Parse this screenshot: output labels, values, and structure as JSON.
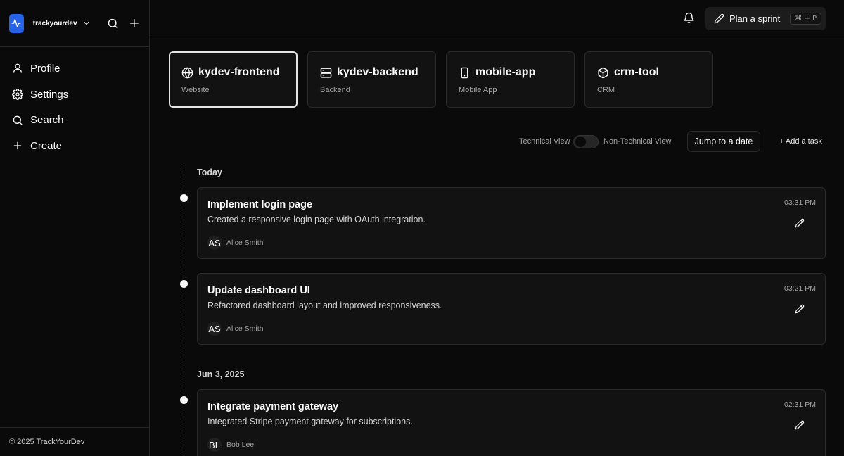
{
  "sidebar": {
    "org_name": "trackyourdev",
    "nav": [
      {
        "label": "Profile",
        "icon": "user-icon"
      },
      {
        "label": "Settings",
        "icon": "gear-icon"
      },
      {
        "label": "Search",
        "icon": "search-icon"
      },
      {
        "label": "Create",
        "icon": "plus-icon"
      }
    ],
    "footer": "© 2025 TrackYourDev"
  },
  "topbar": {
    "plan_label": "Plan a sprint",
    "plan_shortcut": "⌘ + P"
  },
  "projects": [
    {
      "name": "kydev-frontend",
      "type": "Website",
      "icon": "globe-icon",
      "active": true
    },
    {
      "name": "kydev-backend",
      "type": "Backend",
      "icon": "server-icon",
      "active": false
    },
    {
      "name": "mobile-app",
      "type": "Mobile App",
      "icon": "smartphone-icon",
      "active": false
    },
    {
      "name": "crm-tool",
      "type": "CRM",
      "icon": "package-icon",
      "active": false
    }
  ],
  "controls": {
    "technical_label": "Technical View",
    "non_technical_label": "Non-Technical View",
    "jump_label": "Jump to a date",
    "add_task_label": "+ Add a task"
  },
  "timeline": {
    "groups": [
      {
        "title": "Today",
        "tasks": [
          {
            "title": "Implement login page",
            "description": "Created a responsive login page with OAuth integration.",
            "time": "03:31 PM",
            "initials": "AS",
            "user": "Alice Smith"
          },
          {
            "title": "Update dashboard UI",
            "description": "Refactored dashboard layout and improved responsiveness.",
            "time": "03:21 PM",
            "initials": "AS",
            "user": "Alice Smith"
          }
        ]
      },
      {
        "title": "Jun 3, 2025",
        "tasks": [
          {
            "title": "Integrate payment gateway",
            "description": "Integrated Stripe payment gateway for subscriptions.",
            "time": "02:31 PM",
            "initials": "BL",
            "user": "Bob Lee"
          }
        ]
      }
    ]
  },
  "colors": {
    "background": "#0a0a0a",
    "accent": "#2563eb",
    "card": "#121212",
    "border": "#2a2a2a"
  }
}
